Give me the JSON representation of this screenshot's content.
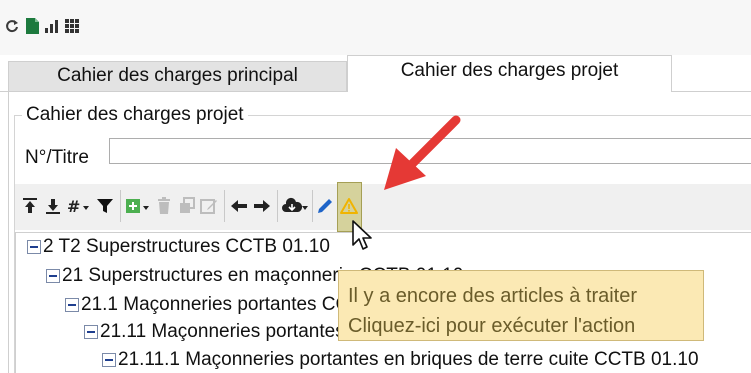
{
  "tabs": [
    {
      "label": "Cahier des charges principal",
      "active": false
    },
    {
      "label": "Cahier des charges projet",
      "active": true
    }
  ],
  "section": {
    "legend": "Cahier des charges projet",
    "field_label": "N°/Titre",
    "field_value": ""
  },
  "top_icons": [
    "refresh-icon",
    "excel-icon",
    "bar-chart-icon",
    "grid-icon"
  ],
  "toolbar": {
    "buttons": [
      "move-top-icon",
      "move-bottom-icon",
      "numbering-dropdown-icon",
      "filter-icon",
      "add-green-dropdown-icon",
      "delete-icon",
      "copy-icon",
      "edit-icon",
      "arrow-left-icon",
      "arrow-right-icon",
      "cloud-download-dropdown-icon",
      "pencil-icon",
      "warning-icon"
    ],
    "highlighted": "warning-icon"
  },
  "tree": [
    {
      "level": 0,
      "label": "2 T2 Superstructures CCTB 01.10"
    },
    {
      "level": 1,
      "label": "21 Superstructures en maçonnerie CCTB 01.10"
    },
    {
      "level": 2,
      "label": "21.1 Maçonneries portantes CCTB 01.10"
    },
    {
      "level": 3,
      "label": "21.11 Maçonneries portantes en briques"
    },
    {
      "level": 4,
      "label": "21.11.1 Maçonneries portantes en briques de terre cuite CCTB 01.10"
    }
  ],
  "tooltip": {
    "line1": "Il y a encore des articles à traiter",
    "line2": "Cliquez-ici pour exécuter l'action"
  },
  "colors": {
    "excel_green": "#1d7a3e",
    "warning_yellow": "#f0b400",
    "highlight_bg": "#d5d29c",
    "tooltip_bg": "#fbe9b4",
    "tooltip_text": "#6a5c2a",
    "annotation_arrow": "#e53935",
    "tree_minus": "#1f3f8f"
  }
}
